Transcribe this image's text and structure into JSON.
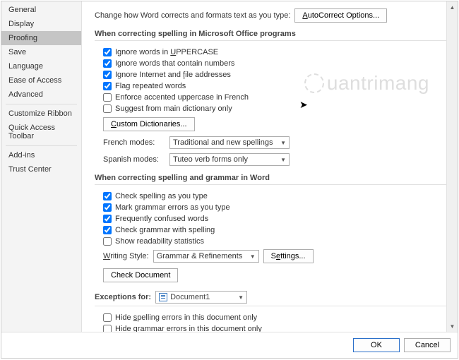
{
  "sidebar": {
    "items": [
      {
        "label": "General"
      },
      {
        "label": "Display"
      },
      {
        "label": "Proofing"
      },
      {
        "label": "Save"
      },
      {
        "label": "Language"
      },
      {
        "label": "Ease of Access"
      },
      {
        "label": "Advanced"
      },
      {
        "label": "Customize Ribbon"
      },
      {
        "label": "Quick Access Toolbar"
      },
      {
        "label": "Add-ins"
      },
      {
        "label": "Trust Center"
      }
    ],
    "selected_index": 2
  },
  "top": {
    "text": "Change how Word corrects and formats text as you type:",
    "button": "AutoCorrect Options..."
  },
  "section1": {
    "header": "When correcting spelling in Microsoft Office programs",
    "checks": [
      {
        "label": "Ignore words in UPPERCASE",
        "checked": true,
        "u": "U"
      },
      {
        "label": "Ignore words that contain numbers",
        "checked": true
      },
      {
        "label": "Ignore Internet and file addresses",
        "checked": true,
        "u": "f"
      },
      {
        "label": "Flag repeated words",
        "checked": true
      },
      {
        "label": "Enforce accented uppercase in French",
        "checked": false
      },
      {
        "label": "Suggest from main dictionary only",
        "checked": false
      }
    ],
    "custom_dict_btn": "Custom Dictionaries...",
    "french_label": "French modes:",
    "french_value": "Traditional and new spellings",
    "spanish_label": "Spanish modes:",
    "spanish_value": "Tuteo verb forms only"
  },
  "section2": {
    "header": "When correcting spelling and grammar in Word",
    "checks": [
      {
        "label": "Check spelling as you type",
        "checked": true
      },
      {
        "label": "Mark grammar errors as you type",
        "checked": true
      },
      {
        "label": "Frequently confused words",
        "checked": true
      },
      {
        "label": "Check grammar with spelling",
        "checked": true
      },
      {
        "label": "Show readability statistics",
        "checked": false
      }
    ],
    "writing_style_label": "Writing Style:",
    "writing_style_value": "Grammar & Refinements",
    "settings_btn": "Settings...",
    "check_doc_btn": "Check Document"
  },
  "section3": {
    "header_label": "Exceptions for:",
    "doc_value": "Document1",
    "checks": [
      {
        "label": "Hide spelling errors in this document only",
        "checked": false
      },
      {
        "label": "Hide grammar errors in this document only",
        "checked": false
      }
    ]
  },
  "footer": {
    "ok": "OK",
    "cancel": "Cancel"
  },
  "watermark": "uantrimang"
}
